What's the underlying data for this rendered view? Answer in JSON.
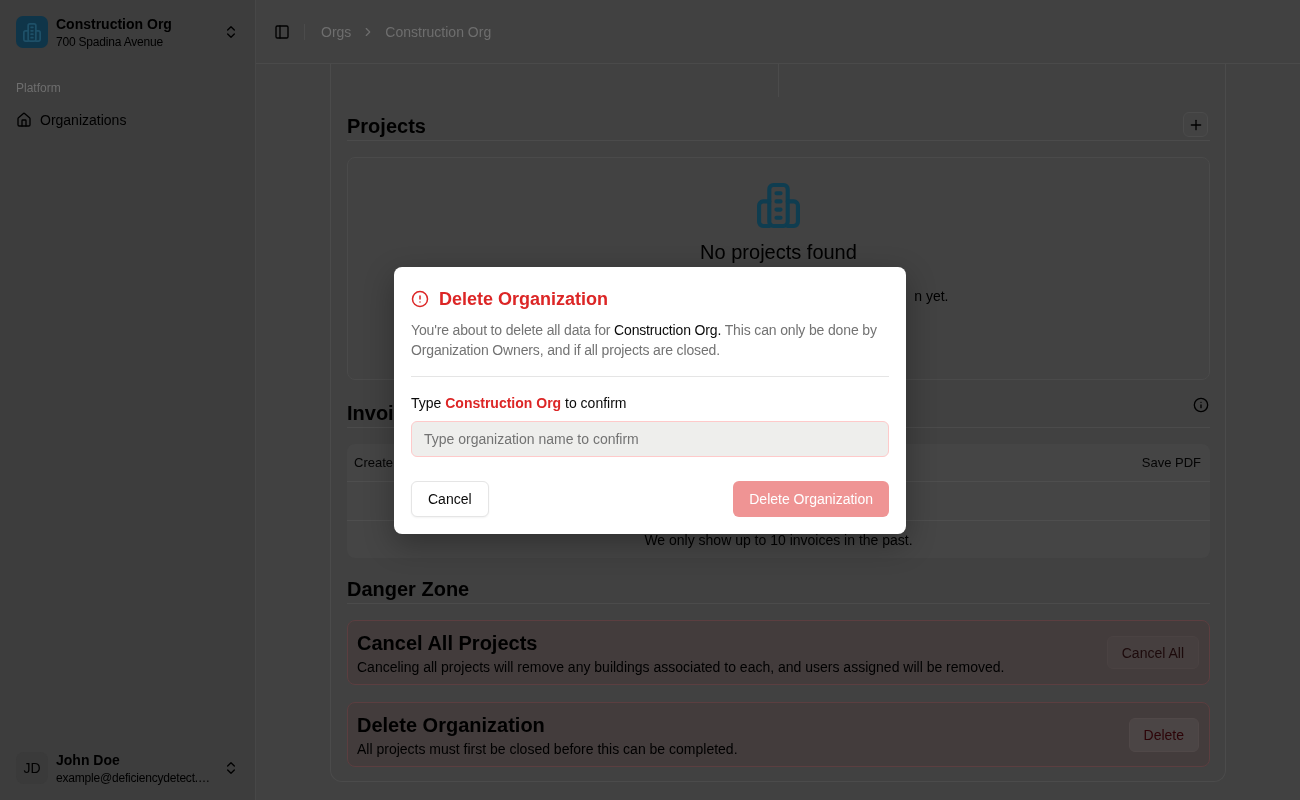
{
  "sidebar": {
    "org_switcher": {
      "name": "Construction Org",
      "address": "700 Spadina Avenue"
    },
    "groups": [
      {
        "label": "Platform",
        "items": [
          {
            "label": "Organizations",
            "selected": false
          }
        ]
      }
    ],
    "user": {
      "initials": "JD",
      "name": "John Doe",
      "email": "example@deficiencydetect.…"
    }
  },
  "header": {
    "breadcrumbs": [
      "Orgs",
      "Construction Org"
    ]
  },
  "projects": {
    "title": "Projects",
    "empty_state": {
      "title": "No projects found",
      "description": "n yet."
    }
  },
  "invoices": {
    "title": "Invoi",
    "table": {
      "columns": [
        "Create",
        "Save PDF"
      ],
      "caption": "We only show up to 10 invoices in the past."
    }
  },
  "danger_zone": {
    "title": "Danger Zone",
    "items": [
      {
        "title": "Cancel All Projects",
        "description": "Canceling all projects will remove any buildings associated to each, and users assigned will be removed.",
        "button": {
          "label": "Cancel All",
          "disabled": true
        }
      },
      {
        "title": "Delete Organization",
        "description": "All projects must first be closed before this can be completed.",
        "button": {
          "label": "Delete",
          "disabled": false
        }
      }
    ]
  },
  "dialog": {
    "title": "Delete Organization",
    "description": "You're about to delete all data for **Construction Org.** This can only be done by Organization Owners, and if all projects are closed.",
    "prompt": "Type **Construction Org** to confirm",
    "input": {
      "placeholder": "Type organization name to confirm"
    },
    "cancel_button": "Cancel",
    "confirm_button": {
      "label": "Delete Organization",
      "disabled": true
    }
  }
}
